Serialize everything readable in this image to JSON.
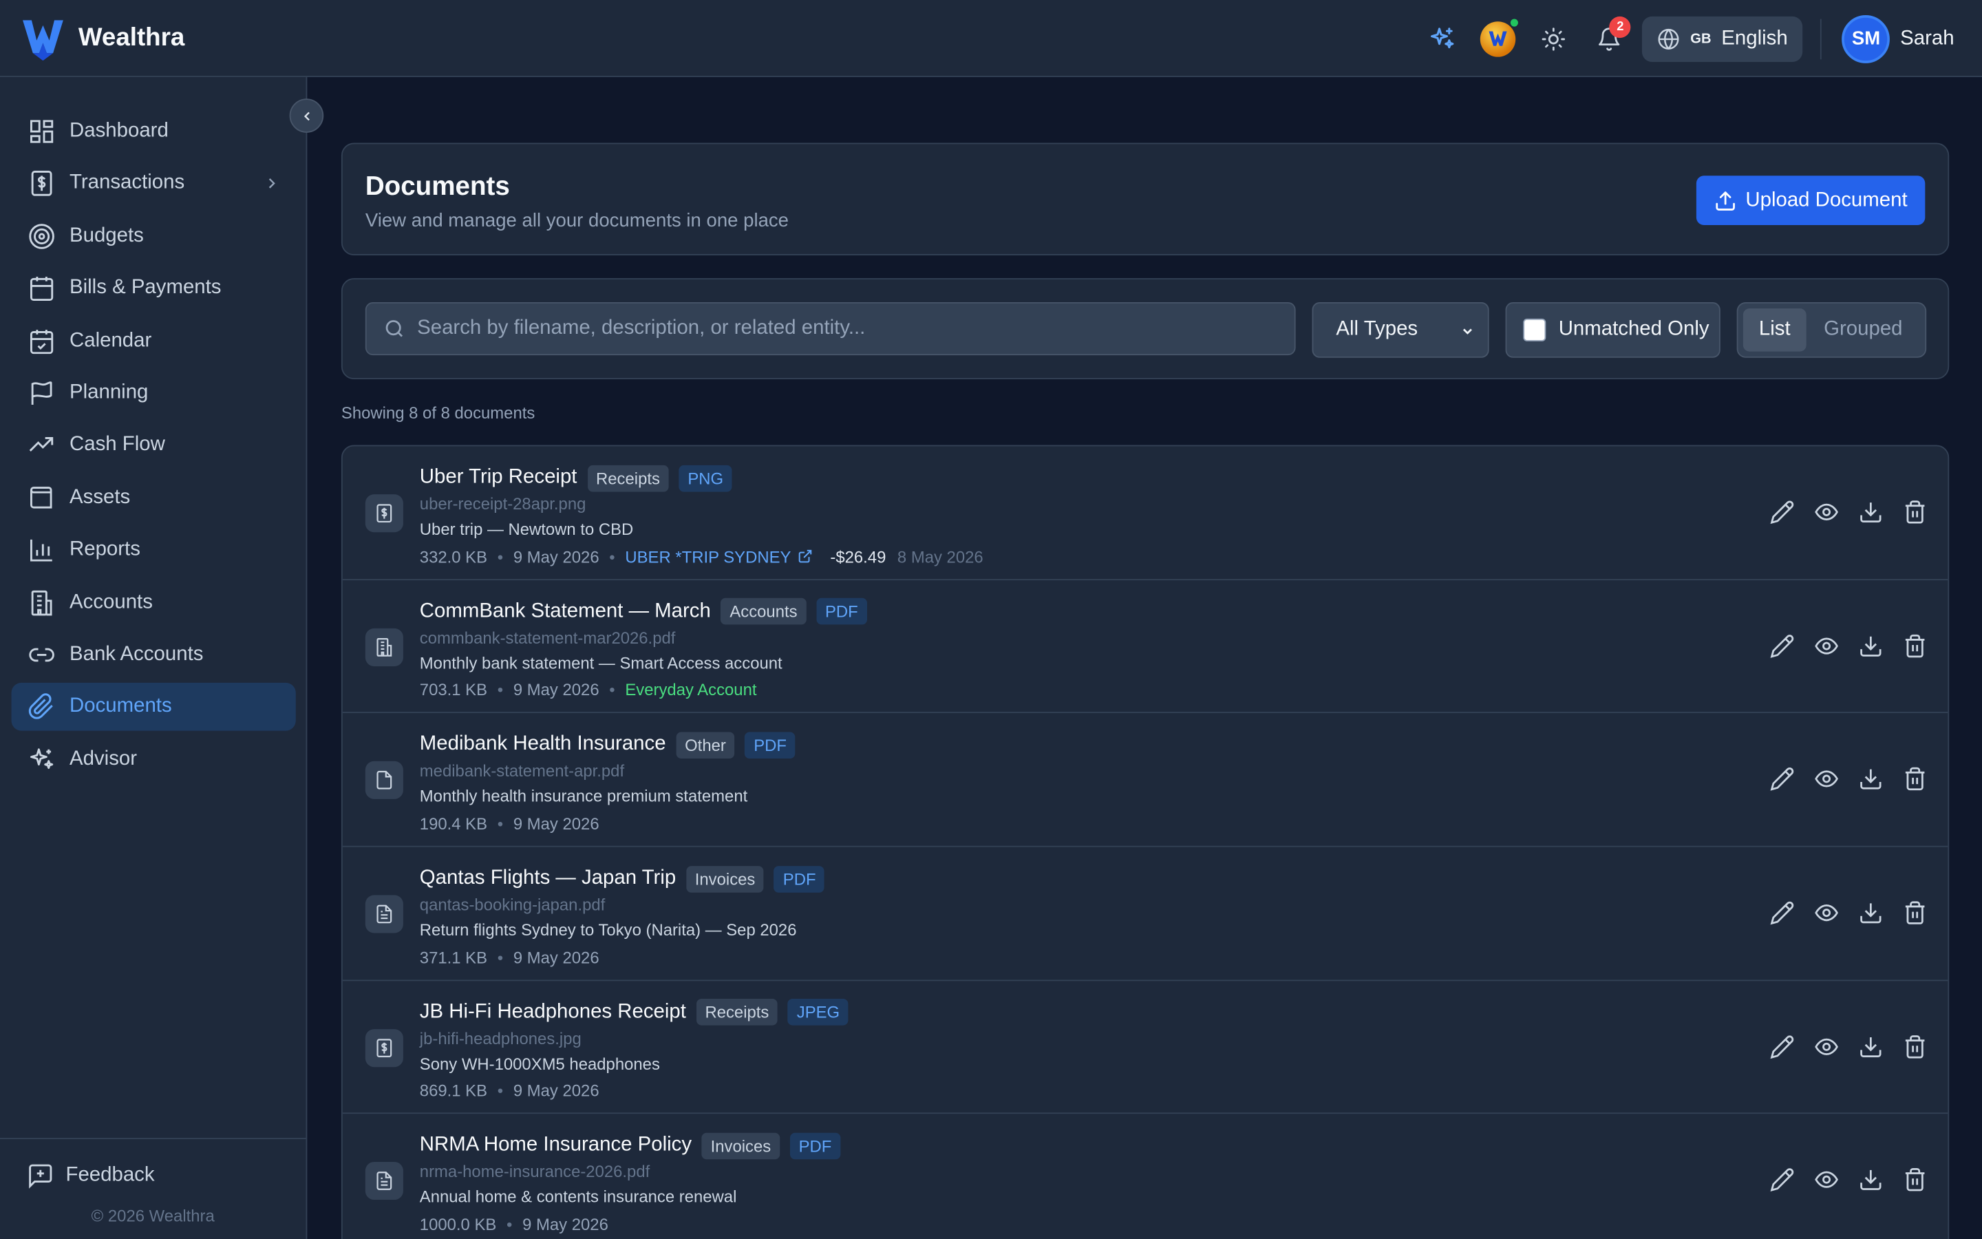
{
  "app": {
    "name": "Wealthra",
    "copyright": "© 2026 Wealthra"
  },
  "topbar": {
    "notification_count": "2",
    "language_flag": "GB",
    "language": "English",
    "user_initials": "SM",
    "user_name": "Sarah"
  },
  "sidebar": {
    "items": [
      {
        "label": "Dashboard",
        "icon": "dashboard-icon"
      },
      {
        "label": "Transactions",
        "icon": "dollar-doc-icon"
      },
      {
        "label": "Budgets",
        "icon": "target-icon"
      },
      {
        "label": "Bills & Payments",
        "icon": "calendar-icon"
      },
      {
        "label": "Calendar",
        "icon": "calendar-check-icon"
      },
      {
        "label": "Planning",
        "icon": "flag-icon"
      },
      {
        "label": "Cash Flow",
        "icon": "trending-up-icon"
      },
      {
        "label": "Assets",
        "icon": "wallet-icon"
      },
      {
        "label": "Reports",
        "icon": "bar-chart-icon"
      },
      {
        "label": "Accounts",
        "icon": "building-icon"
      },
      {
        "label": "Bank Accounts",
        "icon": "link-icon"
      },
      {
        "label": "Documents",
        "icon": "paperclip-icon"
      },
      {
        "label": "Advisor",
        "icon": "sparkles-icon"
      }
    ],
    "active": "Documents",
    "feedback": "Feedback"
  },
  "page": {
    "title": "Documents",
    "subtitle": "View and manage all your documents in one place",
    "upload_label": "Upload Document"
  },
  "filters": {
    "search_placeholder": "Search by filename, description, or related entity...",
    "type_selected": "All Types",
    "unmatched_label": "Unmatched Only",
    "view_list": "List",
    "view_grouped": "Grouped",
    "showing": "Showing 8 of 8 documents"
  },
  "documents": [
    {
      "title": "Uber Trip Receipt",
      "category": "Receipts",
      "type": "PNG",
      "file": "uber-receipt-28apr.png",
      "desc": "Uber trip — Newtown to CBD",
      "size": "332.0 KB",
      "date": "9 May 2026",
      "link": "UBER *TRIP SYDNEY",
      "amount": "-$26.49",
      "date2": "8 May 2026",
      "account": "",
      "icon": "receipt-icon"
    },
    {
      "title": "CommBank Statement — March",
      "category": "Accounts",
      "type": "PDF",
      "file": "commbank-statement-mar2026.pdf",
      "desc": "Monthly bank statement — Smart Access account",
      "size": "703.1 KB",
      "date": "9 May 2026",
      "link": "",
      "amount": "",
      "date2": "",
      "account": "Everyday Account",
      "icon": "building-icon"
    },
    {
      "title": "Medibank Health Insurance",
      "category": "Other",
      "type": "PDF",
      "file": "medibank-statement-apr.pdf",
      "desc": "Monthly health insurance premium statement",
      "size": "190.4 KB",
      "date": "9 May 2026",
      "link": "",
      "amount": "",
      "date2": "",
      "account": "",
      "icon": "file-icon"
    },
    {
      "title": "Qantas Flights — Japan Trip",
      "category": "Invoices",
      "type": "PDF",
      "file": "qantas-booking-japan.pdf",
      "desc": "Return flights Sydney to Tokyo (Narita) — Sep 2026",
      "size": "371.1 KB",
      "date": "9 May 2026",
      "link": "",
      "amount": "",
      "date2": "",
      "account": "",
      "icon": "file-text-icon"
    },
    {
      "title": "JB Hi-Fi Headphones Receipt",
      "category": "Receipts",
      "type": "JPEG",
      "file": "jb-hifi-headphones.jpg",
      "desc": "Sony WH-1000XM5 headphones",
      "size": "869.1 KB",
      "date": "9 May 2026",
      "link": "",
      "amount": "",
      "date2": "",
      "account": "",
      "icon": "receipt-icon"
    },
    {
      "title": "NRMA Home Insurance Policy",
      "category": "Invoices",
      "type": "PDF",
      "file": "nrma-home-insurance-2026.pdf",
      "desc": "Annual home & contents insurance renewal",
      "size": "1000.0 KB",
      "date": "9 May 2026",
      "link": "",
      "amount": "",
      "date2": "",
      "account": "",
      "icon": "file-text-icon"
    }
  ],
  "colors": {
    "accent": "#2563eb",
    "bg": "#0f172a",
    "panel": "#1e293b",
    "border": "#334155",
    "link": "#60a5fa",
    "success": "#4ade80"
  }
}
